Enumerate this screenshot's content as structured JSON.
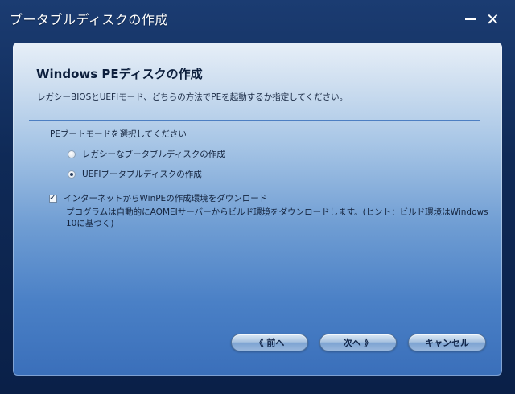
{
  "window": {
    "title": "ブータブルディスクの作成",
    "minimize_label": "",
    "close_label": "✕"
  },
  "content": {
    "heading": "Windows PEディスクの作成",
    "subheading": "レガシーBIOSとUEFIモード、どちらの方法でPEを起動するか指定してください。",
    "section_label": "PEブートモードを選択してください",
    "options": [
      {
        "label": "レガシーなブータブルディスクの作成",
        "selected": false
      },
      {
        "label": "UEFIブータブルディスクの作成",
        "selected": true
      }
    ],
    "download": {
      "label": "インターネットからWinPEの作成環境をダウンロード",
      "checked": true,
      "check_mark": "✓",
      "description": "プログラムは自動的にAOMEIサーバーからビルド環境をダウンロードします。(ヒント：ビルド環境はWindows 10に基づく)"
    }
  },
  "buttons": {
    "back": "《 前へ",
    "next": "次へ 》",
    "cancel": "キャンセル"
  }
}
